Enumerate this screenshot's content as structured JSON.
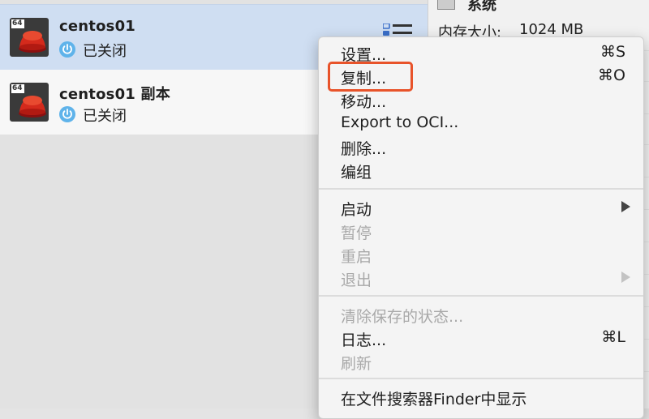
{
  "vm_list": [
    {
      "name": "centos01",
      "state": "已关闭",
      "badge": "64",
      "selected": true
    },
    {
      "name": "centos01 副本",
      "state": "已关闭",
      "badge": "64",
      "selected": false
    }
  ],
  "details": {
    "section_title": "系统",
    "rows": [
      {
        "key": "内存大小:",
        "value": "1024 MB"
      }
    ]
  },
  "context_menu": {
    "items": [
      {
        "label": "设置...",
        "shortcut": "⌘S",
        "enabled": true
      },
      {
        "label": "复制...",
        "shortcut": "⌘O",
        "enabled": true,
        "highlighted": true
      },
      {
        "label": "移动...",
        "shortcut": "",
        "enabled": true
      },
      {
        "label": "Export to OCI...",
        "shortcut": "",
        "enabled": true
      },
      {
        "label": "删除...",
        "shortcut": "",
        "enabled": true
      },
      {
        "label": "编组",
        "shortcut": "",
        "enabled": true
      },
      {
        "label": "启动",
        "submenu": true,
        "enabled": true
      },
      {
        "label": "暂停",
        "enabled": false
      },
      {
        "label": "重启",
        "enabled": false
      },
      {
        "label": "退出",
        "submenu": true,
        "enabled": false
      },
      {
        "label": "清除保存的状态...",
        "enabled": false
      },
      {
        "label": "日志...",
        "shortcut": "⌘L",
        "enabled": true
      },
      {
        "label": "刷新",
        "enabled": false
      },
      {
        "label": "在文件搜索器Finder中显示",
        "enabled": true
      }
    ]
  },
  "colors": {
    "selected_row": "#cfdef2",
    "highlight_box": "#e8532a",
    "power_icon": "#5fb3ea"
  }
}
